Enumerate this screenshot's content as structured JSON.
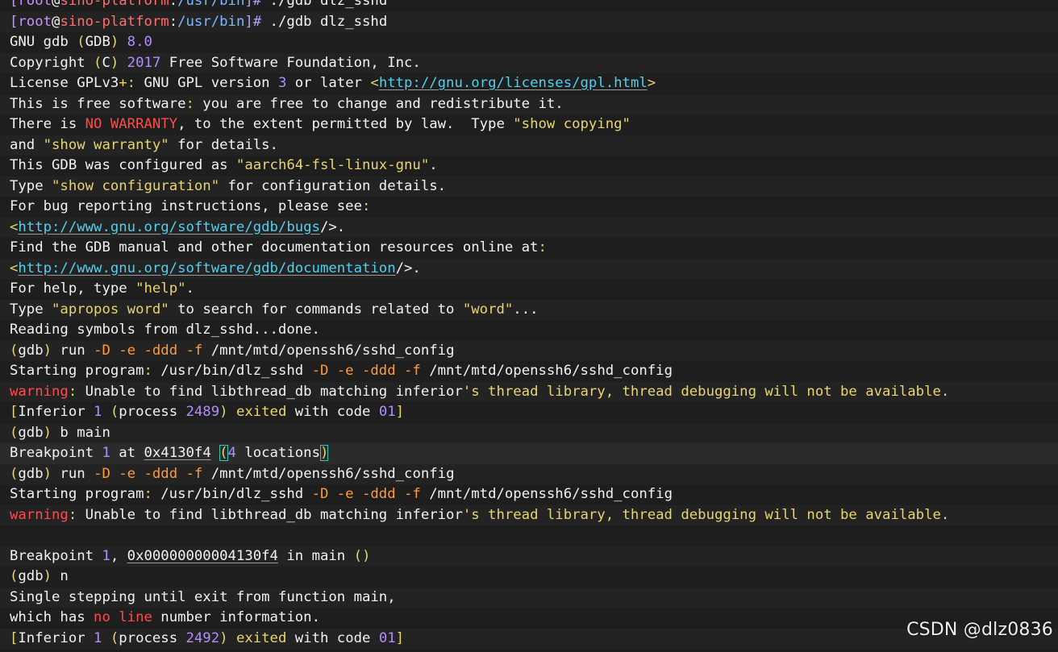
{
  "terminal": {
    "lines": [
      [
        {
          "t": "[",
          "c": "punct"
        },
        {
          "t": "root",
          "c": "user"
        },
        {
          "t": "@",
          "c": "text"
        },
        {
          "t": "sino-platform",
          "c": "host"
        },
        {
          "t": ":",
          "c": "text"
        },
        {
          "t": "/usr/bin",
          "c": "path"
        },
        {
          "t": "]#",
          "c": "punct"
        },
        {
          "t": " ./gdb dlz_sshd",
          "c": "text"
        }
      ],
      [
        {
          "t": "[",
          "c": "punct"
        },
        {
          "t": "root",
          "c": "user"
        },
        {
          "t": "@",
          "c": "text"
        },
        {
          "t": "sino-platform",
          "c": "host"
        },
        {
          "t": ":",
          "c": "text"
        },
        {
          "t": "/usr/bin",
          "c": "path"
        },
        {
          "t": "]#",
          "c": "punct"
        },
        {
          "t": " ./gdb dlz_sshd",
          "c": "text"
        }
      ],
      [
        {
          "t": "GNU gdb ",
          "c": "text"
        },
        {
          "t": "(",
          "c": "str"
        },
        {
          "t": "GDB",
          "c": "text"
        },
        {
          "t": ")",
          "c": "str"
        },
        {
          "t": " ",
          "c": "text"
        },
        {
          "t": "8.0",
          "c": "num"
        }
      ],
      [
        {
          "t": "Copyright ",
          "c": "text"
        },
        {
          "t": "(",
          "c": "str"
        },
        {
          "t": "C",
          "c": "text"
        },
        {
          "t": ")",
          "c": "str"
        },
        {
          "t": " ",
          "c": "text"
        },
        {
          "t": "2017",
          "c": "num"
        },
        {
          "t": " Free Software Foundation, Inc.",
          "c": "text"
        }
      ],
      [
        {
          "t": "License GPLv3",
          "c": "text"
        },
        {
          "t": "+:",
          "c": "str"
        },
        {
          "t": " GNU GPL version ",
          "c": "text"
        },
        {
          "t": "3",
          "c": "num"
        },
        {
          "t": " or later ",
          "c": "text"
        },
        {
          "t": "<",
          "c": "str"
        },
        {
          "t": "http://gnu.org/licenses/gpl.html",
          "c": "link"
        },
        {
          "t": ">",
          "c": "str"
        }
      ],
      [
        {
          "t": "This is free software",
          "c": "text"
        },
        {
          "t": ":",
          "c": "str"
        },
        {
          "t": " you are free to change and redistribute it.",
          "c": "text"
        }
      ],
      [
        {
          "t": "There is ",
          "c": "text"
        },
        {
          "t": "NO WARRANTY",
          "c": "red"
        },
        {
          "t": ", to the extent permitted by law.  Type ",
          "c": "text"
        },
        {
          "t": "\"show copying\"",
          "c": "str"
        }
      ],
      [
        {
          "t": "and ",
          "c": "text"
        },
        {
          "t": "\"show warranty\"",
          "c": "str"
        },
        {
          "t": " for details.",
          "c": "text"
        }
      ],
      [
        {
          "t": "This GDB was configured as ",
          "c": "text"
        },
        {
          "t": "\"aarch64-fsl-linux-gnu\"",
          "c": "str"
        },
        {
          "t": ".",
          "c": "text"
        }
      ],
      [
        {
          "t": "Type ",
          "c": "text"
        },
        {
          "t": "\"show configuration\"",
          "c": "str"
        },
        {
          "t": " for configuration details.",
          "c": "text"
        }
      ],
      [
        {
          "t": "For bug reporting instructions, please see",
          "c": "text"
        },
        {
          "t": ":",
          "c": "str"
        }
      ],
      [
        {
          "t": "<",
          "c": "str"
        },
        {
          "t": "http://www.gnu.org/software/gdb/bugs",
          "c": "link"
        },
        {
          "t": "/>.",
          "c": "text"
        }
      ],
      [
        {
          "t": "Find the GDB manual and other documentation resources online at",
          "c": "text"
        },
        {
          "t": ":",
          "c": "str"
        }
      ],
      [
        {
          "t": "<",
          "c": "str"
        },
        {
          "t": "http://www.gnu.org/software/gdb/documentation",
          "c": "link"
        },
        {
          "t": "/>.",
          "c": "text"
        }
      ],
      [
        {
          "t": "For help, type ",
          "c": "text"
        },
        {
          "t": "\"help\"",
          "c": "str"
        },
        {
          "t": ".",
          "c": "text"
        }
      ],
      [
        {
          "t": "Type ",
          "c": "text"
        },
        {
          "t": "\"apropos word\"",
          "c": "str"
        },
        {
          "t": " to search for commands related to ",
          "c": "text"
        },
        {
          "t": "\"word\"",
          "c": "str"
        },
        {
          "t": "...",
          "c": "text"
        }
      ],
      [
        {
          "t": "Reading symbols from dlz_sshd...done.",
          "c": "text"
        }
      ],
      [
        {
          "t": "(",
          "c": "str"
        },
        {
          "t": "gdb",
          "c": "text"
        },
        {
          "t": ")",
          "c": "str"
        },
        {
          "t": " run ",
          "c": "text"
        },
        {
          "t": "-D",
          "c": "orange"
        },
        {
          "t": " ",
          "c": "text"
        },
        {
          "t": "-e",
          "c": "orange"
        },
        {
          "t": " ",
          "c": "text"
        },
        {
          "t": "-ddd",
          "c": "orange"
        },
        {
          "t": " ",
          "c": "text"
        },
        {
          "t": "-f",
          "c": "orange"
        },
        {
          "t": " /mnt/mtd/openssh6/sshd_config",
          "c": "text"
        }
      ],
      [
        {
          "t": "Starting program",
          "c": "text"
        },
        {
          "t": ":",
          "c": "str"
        },
        {
          "t": " /usr/bin/dlz_sshd ",
          "c": "text"
        },
        {
          "t": "-D",
          "c": "orange"
        },
        {
          "t": " ",
          "c": "text"
        },
        {
          "t": "-e",
          "c": "orange"
        },
        {
          "t": " ",
          "c": "text"
        },
        {
          "t": "-ddd",
          "c": "orange"
        },
        {
          "t": " ",
          "c": "text"
        },
        {
          "t": "-f",
          "c": "orange"
        },
        {
          "t": " /mnt/mtd/openssh6/sshd_config",
          "c": "text"
        }
      ],
      [
        {
          "t": "warning",
          "c": "red"
        },
        {
          "t": ":",
          "c": "str"
        },
        {
          "t": " Unable to find libthread_db matching inferior",
          "c": "text"
        },
        {
          "t": "'s thread library, thread debugging will not be available.",
          "c": "str"
        }
      ],
      [
        {
          "t": "[",
          "c": "str"
        },
        {
          "t": "Inferior ",
          "c": "text"
        },
        {
          "t": "1",
          "c": "num"
        },
        {
          "t": " ",
          "c": "text"
        },
        {
          "t": "(",
          "c": "str"
        },
        {
          "t": "process ",
          "c": "text"
        },
        {
          "t": "2489",
          "c": "num"
        },
        {
          "t": ")",
          "c": "str"
        },
        {
          "t": " ",
          "c": "text"
        },
        {
          "t": "exited",
          "c": "str"
        },
        {
          "t": " with code ",
          "c": "text"
        },
        {
          "t": "01",
          "c": "num"
        },
        {
          "t": "]",
          "c": "str"
        }
      ],
      [
        {
          "t": "(",
          "c": "str"
        },
        {
          "t": "gdb",
          "c": "text"
        },
        {
          "t": ")",
          "c": "str"
        },
        {
          "t": " b main",
          "c": "text"
        }
      ],
      [
        {
          "t": "Breakpoint ",
          "c": "text"
        },
        {
          "t": "1",
          "c": "num"
        },
        {
          "t": " at ",
          "c": "text"
        },
        {
          "t": "0x4130f4",
          "c": "uline"
        },
        {
          "t": " ",
          "c": "text"
        },
        {
          "t": "(",
          "c": "str",
          "m": true
        },
        {
          "t": "4",
          "c": "num"
        },
        {
          "t": " locations",
          "c": "text"
        },
        {
          "t": ")",
          "c": "str",
          "m": true
        }
      ],
      [
        {
          "t": "(",
          "c": "str"
        },
        {
          "t": "gdb",
          "c": "text"
        },
        {
          "t": ")",
          "c": "str"
        },
        {
          "t": " run ",
          "c": "text"
        },
        {
          "t": "-D",
          "c": "orange"
        },
        {
          "t": " ",
          "c": "text"
        },
        {
          "t": "-e",
          "c": "orange"
        },
        {
          "t": " ",
          "c": "text"
        },
        {
          "t": "-ddd",
          "c": "orange"
        },
        {
          "t": " ",
          "c": "text"
        },
        {
          "t": "-f",
          "c": "orange"
        },
        {
          "t": " /mnt/mtd/openssh6/sshd_config",
          "c": "text"
        }
      ],
      [
        {
          "t": "Starting program",
          "c": "text"
        },
        {
          "t": ":",
          "c": "str"
        },
        {
          "t": " /usr/bin/dlz_sshd ",
          "c": "text"
        },
        {
          "t": "-D",
          "c": "orange"
        },
        {
          "t": " ",
          "c": "text"
        },
        {
          "t": "-e",
          "c": "orange"
        },
        {
          "t": " ",
          "c": "text"
        },
        {
          "t": "-ddd",
          "c": "orange"
        },
        {
          "t": " ",
          "c": "text"
        },
        {
          "t": "-f",
          "c": "orange"
        },
        {
          "t": " /mnt/mtd/openssh6/sshd_config",
          "c": "text"
        }
      ],
      [
        {
          "t": "warning",
          "c": "red"
        },
        {
          "t": ":",
          "c": "str"
        },
        {
          "t": " Unable to find libthread_db matching inferior",
          "c": "text"
        },
        {
          "t": "'s thread library, thread debugging will not be available.",
          "c": "str"
        }
      ],
      [],
      [
        {
          "t": "Breakpoint ",
          "c": "text"
        },
        {
          "t": "1",
          "c": "num"
        },
        {
          "t": ", ",
          "c": "text"
        },
        {
          "t": "0x00000000004130f4",
          "c": "uline"
        },
        {
          "t": " in main ",
          "c": "text"
        },
        {
          "t": "()",
          "c": "str"
        }
      ],
      [
        {
          "t": "(",
          "c": "str"
        },
        {
          "t": "gdb",
          "c": "text"
        },
        {
          "t": ")",
          "c": "str"
        },
        {
          "t": " n",
          "c": "text"
        }
      ],
      [
        {
          "t": "Single stepping until exit from function main,",
          "c": "text"
        }
      ],
      [
        {
          "t": "which has ",
          "c": "text"
        },
        {
          "t": "no",
          "c": "red"
        },
        {
          "t": " ",
          "c": "text"
        },
        {
          "t": "line",
          "c": "red"
        },
        {
          "t": " number information.",
          "c": "text"
        }
      ],
      [
        {
          "t": "[",
          "c": "str"
        },
        {
          "t": "Inferior ",
          "c": "text"
        },
        {
          "t": "1",
          "c": "num"
        },
        {
          "t": " ",
          "c": "text"
        },
        {
          "t": "(",
          "c": "str"
        },
        {
          "t": "process ",
          "c": "text"
        },
        {
          "t": "2492",
          "c": "num"
        },
        {
          "t": ")",
          "c": "str"
        },
        {
          "t": " ",
          "c": "text"
        },
        {
          "t": "exited",
          "c": "str"
        },
        {
          "t": " with code ",
          "c": "text"
        },
        {
          "t": "01",
          "c": "num"
        },
        {
          "t": "]",
          "c": "str"
        }
      ]
    ],
    "current_line": 22
  },
  "watermark": {
    "text": "CSDN @dlz0836"
  },
  "colors": {
    "background": "#1e1e1e",
    "text": "#f2f2f2",
    "string": "#e8d56f",
    "number": "#b38cff",
    "error": "#ff4b4b",
    "option": "#ff9a3c",
    "link": "#4fd0ee"
  }
}
